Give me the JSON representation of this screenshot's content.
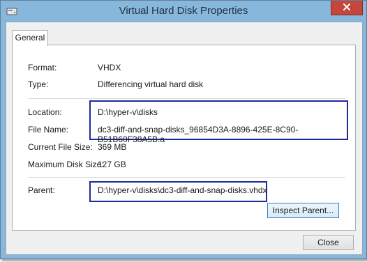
{
  "window": {
    "title": "Virtual Hard Disk Properties",
    "app_icon": "hard-disk-icon",
    "close_icon": "close-icon"
  },
  "tabs": [
    {
      "label": "General"
    }
  ],
  "fields": {
    "format": {
      "label": "Format:",
      "value": "VHDX"
    },
    "type": {
      "label": "Type:",
      "value": "Differencing virtual hard disk"
    },
    "location": {
      "label": "Location:",
      "value": "D:\\hyper-v\\disks"
    },
    "file_name": {
      "label": "File Name:",
      "value": "dc3-diff-and-snap-disks_96854D3A-8896-425E-8C90-B51B60F38A5B.a"
    },
    "current_size": {
      "label": "Current File Size:",
      "value": "369 MB"
    },
    "max_size": {
      "label": "Maximum Disk Size:",
      "value": "127 GB"
    },
    "parent": {
      "label": "Parent:",
      "value": "D:\\hyper-v\\disks\\dc3-diff-and-snap-disks.vhdx"
    }
  },
  "buttons": {
    "inspect_parent": "Inspect Parent...",
    "close": "Close"
  },
  "colors": {
    "highlight_box": "#1a2ba0",
    "close_button_red": "#c7463a",
    "frame": "#88b7dc"
  }
}
